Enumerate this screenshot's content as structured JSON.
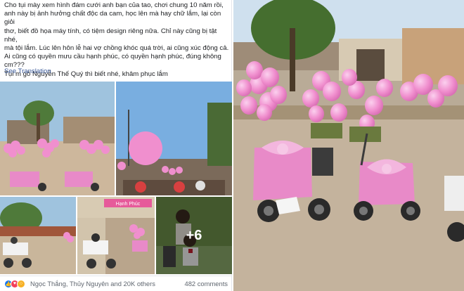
{
  "post": {
    "text_lines": [
      "Cho tụi mày xem hình đám cưới anh bạn của tao, chơi chung 10 năm rồi,",
      "anh này bị ảnh hưởng chất độc da cam, học lên mà hay chữ lắm, lại còn giỏi",
      "thơ, biết đồ họa máy tính, có tiệm design riêng nữa. Chỉ này cũng bị tật nhé,",
      "mà tội lắm. Lúc lên hôn lễ hai vợ chồng khóc quá trời, ai cũng xúc động cả.",
      "Ai cũng có quyền mưu cầu hạnh phúc, có quyền hạnh phúc, đúng không",
      "cm???",
      "Tụi m gõ Nguyễn Thế Quý thì biết nhé, khâm phục lắm"
    ],
    "see_translation": "See Translation"
  },
  "gallery": {
    "more_count": "+6",
    "banner_text": "Hạnh Phúc"
  },
  "reactions": {
    "icons": [
      "like-icon",
      "love-icon",
      "wow-icon"
    ],
    "reactors": "Ngọc Thắng, Thủy Nguyên and 20K others",
    "comments": "482 comments"
  },
  "colors": {
    "link": "#385898",
    "text": "#1c1e21",
    "meta": "#606770",
    "balloon": "#f08fce",
    "ribbon": "#e88ac8"
  }
}
